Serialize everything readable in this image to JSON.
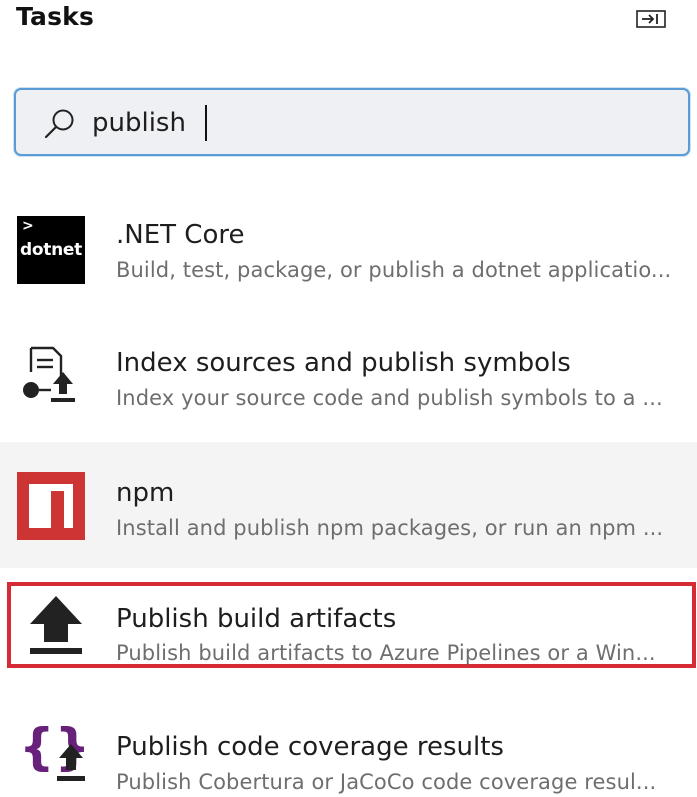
{
  "header": {
    "title": "Tasks",
    "collapse_icon": "collapse-panel-icon"
  },
  "search": {
    "value": "publish",
    "icon": "search-icon"
  },
  "tasks": [
    {
      "name": ".NET Core",
      "description": "Build, test, package, or publish a dotnet applicatio...",
      "icon": "dotnet-logo",
      "icon_text": "dotnet"
    },
    {
      "name": "Index sources and publish symbols",
      "description": "Index your source code and publish symbols to a ...",
      "icon": "index-symbols-icon"
    },
    {
      "name": "npm",
      "description": "Install and publish npm packages, or run an npm ...",
      "icon": "npm-logo"
    },
    {
      "name": "Publish build artifacts",
      "description": "Publish build artifacts to Azure Pipelines or a Win...",
      "icon": "upload-arrow-icon"
    },
    {
      "name": "Publish code coverage results",
      "description": "Publish Cobertura or JaCoCo code coverage resul...",
      "icon": "code-coverage-icon"
    }
  ],
  "colors": {
    "selection_border": "#d62a35",
    "search_border": "#5b9bd5",
    "npm_red": "#cc3534",
    "coverage_purple": "#68217a",
    "description_gray": "#6e6e6e"
  }
}
